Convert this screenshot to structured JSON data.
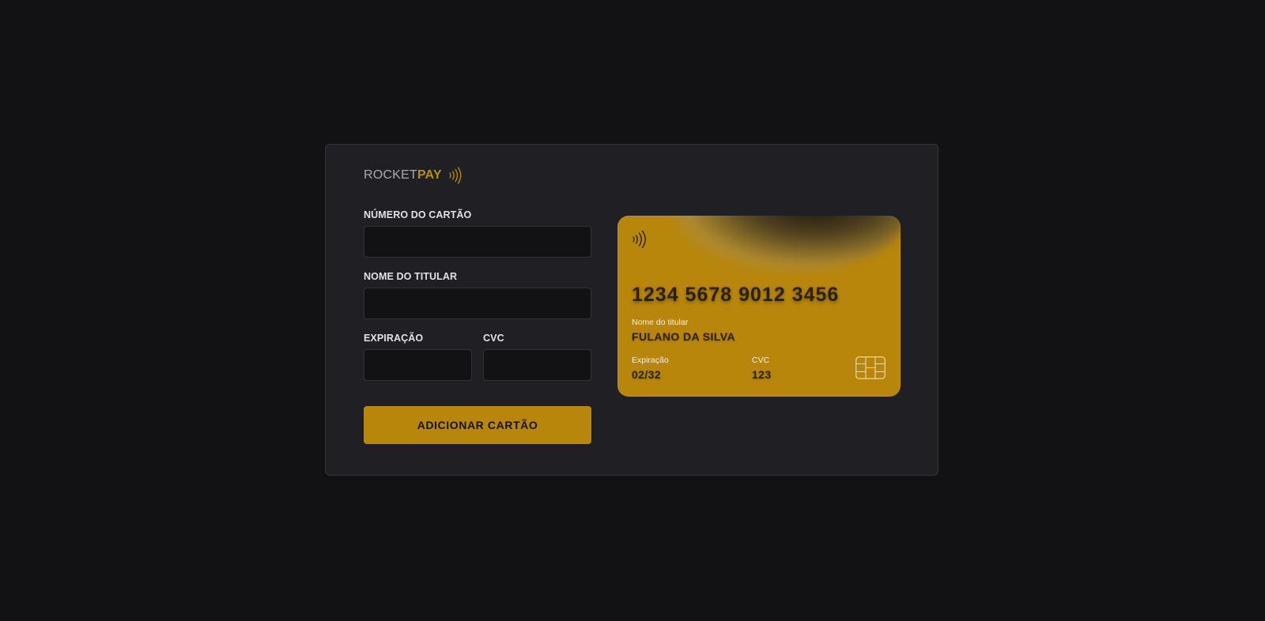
{
  "brand": {
    "rocket": "ROCKET",
    "pay": "PAY",
    "icon": "contactless-icon",
    "accent": "#b8860b"
  },
  "form": {
    "card_number_label": "NÚMERO DO CARTÃO",
    "card_number_value": "",
    "holder_label": "NOME DO TITULAR",
    "holder_value": "",
    "expiration_label": "EXPIRAÇÃO",
    "expiration_value": "",
    "cvc_label": "CVC",
    "cvc_value": "",
    "submit_label": "ADICIONAR CARTÃO"
  },
  "card_preview": {
    "number": "1234 5678 9012 3456",
    "holder_label": "Nome do titular",
    "holder_name": "FULANO DA SILVA",
    "expiration_label": "Expiração",
    "expiration_value": "02/32",
    "cvc_label": "CVC",
    "cvc_value": "123",
    "contactless_icon": "contactless-icon",
    "chip_icon": "chip-icon",
    "card_color": "#b8860b"
  },
  "colors": {
    "background": "#121214",
    "panel": "#202024",
    "input_bg": "#121214",
    "border": "#323238",
    "label_text": "#e1e1e6"
  }
}
